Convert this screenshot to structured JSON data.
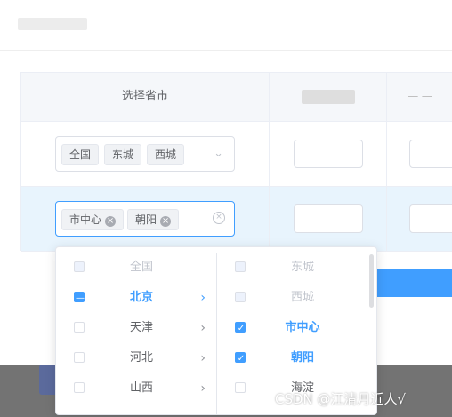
{
  "watermark": "CSDN @江清月近人√",
  "table": {
    "header_region": "选择省市",
    "header_blur_2": "一 一"
  },
  "rows": [
    {
      "tags": [
        "全国",
        "东城",
        "西城"
      ]
    },
    {
      "tags": [
        "市中心",
        "朝阳"
      ]
    }
  ],
  "dropdown": {
    "provinces": [
      {
        "label": "全国",
        "state": "disabled"
      },
      {
        "label": "北京",
        "state": "indeterminate",
        "active": true
      },
      {
        "label": "天津",
        "state": "unchecked"
      },
      {
        "label": "河北",
        "state": "unchecked"
      },
      {
        "label": "山西",
        "state": "unchecked"
      }
    ],
    "districts": [
      {
        "label": "东城",
        "state": "disabled"
      },
      {
        "label": "西城",
        "state": "disabled"
      },
      {
        "label": "市中心",
        "state": "checked"
      },
      {
        "label": "朝阳",
        "state": "checked"
      },
      {
        "label": "海淀",
        "state": "unchecked"
      }
    ]
  },
  "colors": {
    "primary": "#409eff",
    "row_highlight": "#e8f4fd",
    "header_bg": "#f5f7fa"
  }
}
